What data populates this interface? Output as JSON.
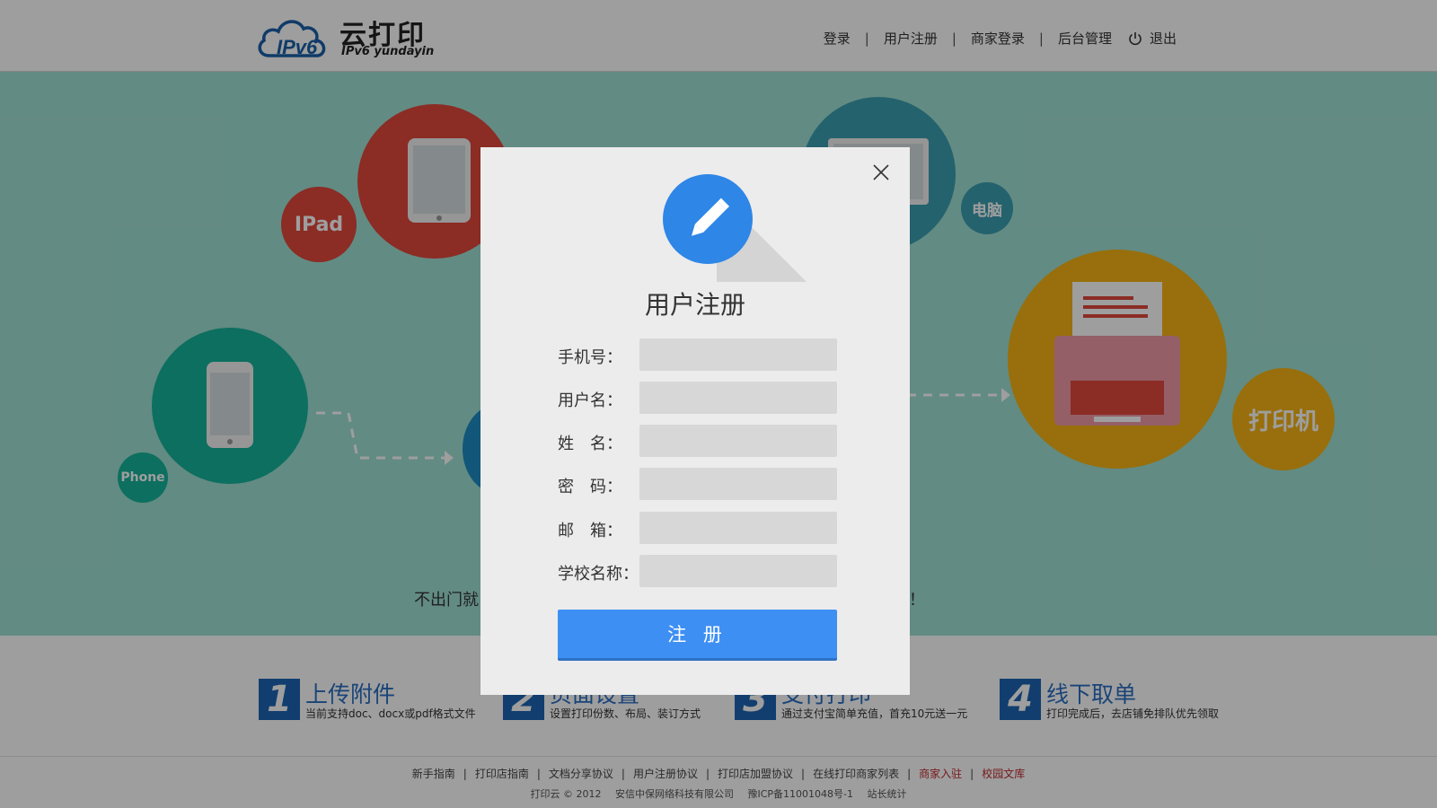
{
  "header": {
    "logo": {
      "cn": "云打印",
      "en": "IPv6 yundayin",
      "mark": "IPv6"
    },
    "nav": [
      {
        "label": "登录"
      },
      {
        "label": "用户注册"
      },
      {
        "label": "商家登录"
      },
      {
        "label": "后台管理"
      }
    ],
    "logout_label": "退出"
  },
  "hero": {
    "bubbles": {
      "ipad": "IPad",
      "computer": "电脑",
      "phone": "Phone",
      "printer": "打印机"
    },
    "tagline_start": "不出门就",
    "tagline_end": "！"
  },
  "steps": [
    {
      "num": "1",
      "title": "上传附件",
      "desc": "当前支持doc、docx或pdf格式文件"
    },
    {
      "num": "2",
      "title": "页面设置",
      "desc": "设置打印份数、布局、装订方式"
    },
    {
      "num": "3",
      "title": "支付打印",
      "desc": "通过支付宝简单充值，首充10元送一元"
    },
    {
      "num": "4",
      "title": "线下取单",
      "desc": "打印完成后，去店铺免排队优先领取"
    }
  ],
  "footer": {
    "links": [
      {
        "label": "新手指南",
        "highlight": false
      },
      {
        "label": "打印店指南",
        "highlight": false
      },
      {
        "label": "文档分享协议",
        "highlight": false
      },
      {
        "label": "用户注册协议",
        "highlight": false
      },
      {
        "label": "打印店加盟协议",
        "highlight": false
      },
      {
        "label": "在线打印商家列表",
        "highlight": false
      },
      {
        "label": "商家入驻",
        "highlight": true
      },
      {
        "label": "校园文库",
        "highlight": true
      }
    ],
    "copyright": "打印云 © 2012",
    "company": "安信中保网络科技有限公司",
    "icp": "豫ICP备11001048号-1",
    "stats": "站长统计"
  },
  "modal": {
    "title": "用户注册",
    "fields": [
      {
        "label": "手机号：",
        "value": "",
        "placeholder": ""
      },
      {
        "label": "用户名：",
        "value": "",
        "placeholder": ""
      },
      {
        "label": "姓　名：",
        "value": "",
        "placeholder": ""
      },
      {
        "label": "密　码：",
        "value": "",
        "placeholder": ""
      },
      {
        "label": "邮　箱：",
        "value": "",
        "placeholder": ""
      },
      {
        "label": "学校名称：",
        "value": "",
        "placeholder": ""
      }
    ],
    "submit_label": "注 册"
  },
  "colors": {
    "hero_bg": "#9fe0d4",
    "ipad_circle": "#e0473c",
    "computer_circle": "#3a9fb0",
    "phone_circle": "#16b39a",
    "printer_circle": "#f5b314",
    "step_blue": "#1e64b4",
    "button_blue": "#3e8ff4",
    "footer_red": "#c0282d"
  }
}
